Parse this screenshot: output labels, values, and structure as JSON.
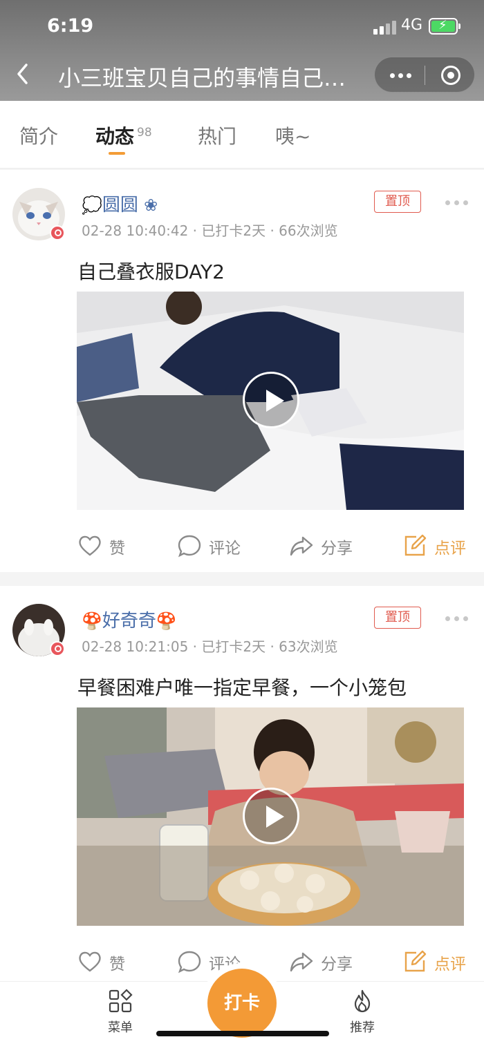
{
  "status_bar": {
    "time": "6:19",
    "network": "4G"
  },
  "header": {
    "title": "小三班宝贝自己的事情自己…",
    "back_icon": "chevron-left-icon",
    "more_icon": "more-dots-icon",
    "close_icon": "target-circle-icon"
  },
  "tabs": [
    {
      "label": "简介"
    },
    {
      "label": "动态",
      "count": "98",
      "active": true
    },
    {
      "label": "热门"
    },
    {
      "label": "咦~"
    }
  ],
  "posts": [
    {
      "user": {
        "prefix": "💭",
        "name": "圆圆",
        "suffix": "❀"
      },
      "meta": "02-28 10:40:42 · 已打卡2天 · 66次浏览",
      "pinned_label": "置顶",
      "text": "自己叠衣服DAY2",
      "actions": {
        "like": "赞",
        "comment": "评论",
        "share": "分享",
        "review": "点评"
      }
    },
    {
      "user": {
        "prefix": "🍄",
        "name": "好奇奇",
        "suffix": "🍄"
      },
      "meta": "02-28 10:21:05 · 已打卡2天 · 63次浏览",
      "pinned_label": "置顶",
      "text": "早餐困难户唯一指定早餐，一个小笼包",
      "actions": {
        "like": "赞",
        "comment": "评论",
        "share": "分享",
        "review": "点评"
      }
    }
  ],
  "bottom_nav": {
    "menu": "菜单",
    "checkin": "打卡",
    "recommend": "推荐"
  },
  "colors": {
    "accent": "#f39a36",
    "pin": "#e05a4e",
    "username": "#4a6ea9"
  }
}
